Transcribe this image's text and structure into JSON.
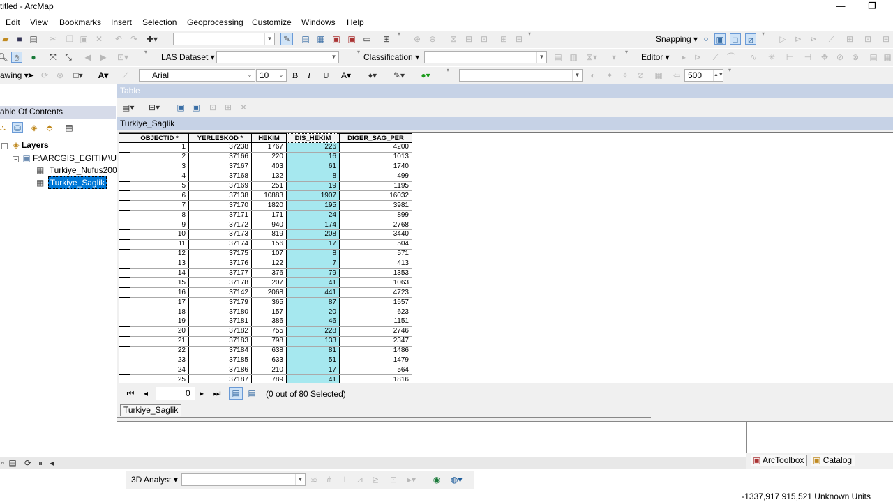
{
  "window": {
    "title": "titled - ArcMap",
    "minimize": "—",
    "restore": "❐"
  },
  "menu": [
    "Edit",
    "View",
    "Bookmarks",
    "Insert",
    "Selection",
    "Geoprocessing",
    "Customize",
    "Windows",
    "Help"
  ],
  "toolbar2": {
    "las_dataset": "LAS Dataset ▾",
    "classification": "Classification ▾",
    "editor": "Editor ▾"
  },
  "toolbar1": {
    "snapping": "Snapping ▾"
  },
  "toolbar3": {
    "drawing": "awing ▾",
    "font": "Arial",
    "font_size": "10",
    "bold": "B",
    "italic": "I",
    "underline": "U",
    "scale_value": "500"
  },
  "toc": {
    "header": "able Of Contents",
    "layers_label": "Layers",
    "folder": "F:\\ARCGIS_EGITIM\\U",
    "items": [
      "Turkiye_Nufus200",
      "Turkiye_Saglik"
    ]
  },
  "table": {
    "window_title": "Table",
    "tab_name": "Turkiye_Saglik",
    "columns": [
      "OBJECTID *",
      "YERLESKOD *",
      "HEKIM",
      "DIS_HEKIM",
      "DIGER_SAG_PER"
    ],
    "rows": [
      [
        "1",
        "37238",
        "1767",
        "226",
        "4200"
      ],
      [
        "2",
        "37166",
        "220",
        "16",
        "1013"
      ],
      [
        "3",
        "37167",
        "403",
        "61",
        "1740"
      ],
      [
        "4",
        "37168",
        "132",
        "8",
        "499"
      ],
      [
        "5",
        "37169",
        "251",
        "19",
        "1195"
      ],
      [
        "6",
        "37138",
        "10883",
        "1907",
        "16032"
      ],
      [
        "7",
        "37170",
        "1820",
        "195",
        "3981"
      ],
      [
        "8",
        "37171",
        "171",
        "24",
        "899"
      ],
      [
        "9",
        "37172",
        "940",
        "174",
        "2768"
      ],
      [
        "10",
        "37173",
        "819",
        "208",
        "3440"
      ],
      [
        "11",
        "37174",
        "156",
        "17",
        "504"
      ],
      [
        "12",
        "37175",
        "107",
        "8",
        "571"
      ],
      [
        "13",
        "37176",
        "122",
        "7",
        "413"
      ],
      [
        "14",
        "37177",
        "376",
        "79",
        "1353"
      ],
      [
        "15",
        "37178",
        "207",
        "41",
        "1063"
      ],
      [
        "16",
        "37142",
        "2068",
        "441",
        "4723"
      ],
      [
        "17",
        "37179",
        "365",
        "87",
        "1557"
      ],
      [
        "18",
        "37180",
        "157",
        "20",
        "623"
      ],
      [
        "19",
        "37181",
        "386",
        "46",
        "1151"
      ],
      [
        "20",
        "37182",
        "755",
        "228",
        "2746"
      ],
      [
        "21",
        "37183",
        "798",
        "133",
        "2347"
      ],
      [
        "22",
        "37184",
        "638",
        "81",
        "1486"
      ],
      [
        "23",
        "37185",
        "633",
        "51",
        "1479"
      ],
      [
        "24",
        "37186",
        "210",
        "17",
        "564"
      ],
      [
        "25",
        "37187",
        "789",
        "41",
        "1816"
      ]
    ],
    "record_value": "0",
    "selection_status": "(0 out of 80 Selected)",
    "bottom_tab": "Turkiye_Saglik"
  },
  "bottom_toolbar": {
    "analyst": "3D Analyst ▾"
  },
  "dock_tabs": [
    "ArcToolbox",
    "Catalog"
  ],
  "coordinates": "-1337,917  915,521 Unknown Units",
  "colors": {
    "highlight_column": "#a6e8ef",
    "titlebar_blue": "#c6d2e6",
    "selected_layer": "#0078d7"
  }
}
